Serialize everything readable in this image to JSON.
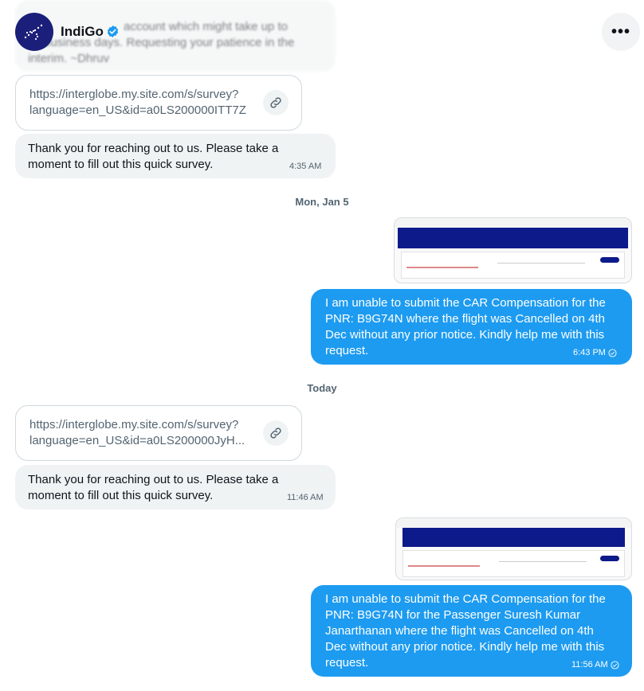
{
  "header": {
    "brand_name": "IndiGo",
    "more_glyph": "•••",
    "brand_color": "#1b1f7a",
    "verified_color": "#1d9bf0"
  },
  "messages": {
    "top_partial": {
      "line1": "account which might take up to",
      "line2": "business days. Requesting your patience in the",
      "line3": "interim. ~Dhruv"
    },
    "link1": {
      "line1": "https://interglobe.my.site.com/s/survey?",
      "line2": "language=en_US&id=a0LS200000ITT7Z"
    },
    "survey1": {
      "line1": "Thank you for reaching out to us. Please take a",
      "line2": "moment to fill out this quick survey.",
      "time": "4:35 AM"
    },
    "sep1": "Mon, Jan 5",
    "out1": {
      "lines": [
        "I am unable to submit the CAR Compensation for the",
        "PNR: B9G74N where the flight was Cancelled on 4th",
        "Dec without any prior notice. Kindly help me with this",
        "request."
      ],
      "time": "6:43 PM"
    },
    "sep2": "Today",
    "link2": {
      "line1": "https://interglobe.my.site.com/s/survey?",
      "line2": "language=en_US&id=a0LS200000JyH..."
    },
    "survey2": {
      "line1": "Thank you for reaching out to us. Please take a",
      "line2": "moment to fill out this quick survey.",
      "time": "11:46 AM"
    },
    "out2": {
      "lines": [
        "I am unable to submit the CAR Compensation for the",
        "PNR: B9G74N for the Passenger Suresh Kumar",
        "Janarthanan where the flight was Cancelled on 4th",
        "Dec without any prior notice. Kindly help me with this",
        "request."
      ],
      "time": "11:56 AM"
    }
  },
  "colors": {
    "incoming_bubble": "#eff3f4",
    "outgoing_bubble": "#1d9bf0",
    "screenshot_banner": "#0d1a8a"
  }
}
